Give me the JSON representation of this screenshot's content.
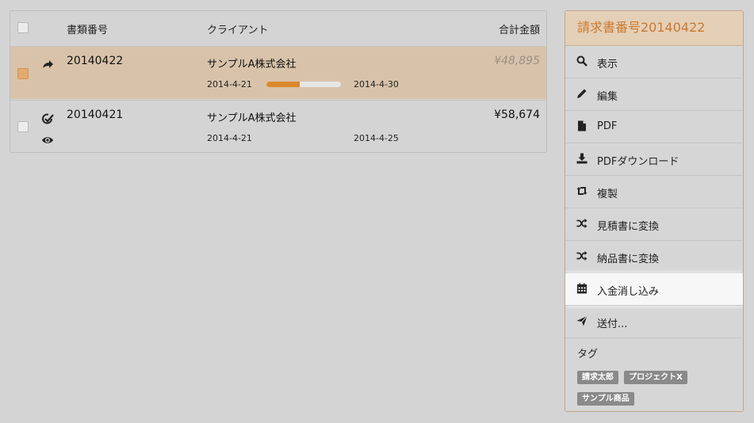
{
  "table": {
    "headers": {
      "number": "書類番号",
      "client": "クライアント",
      "total": "合計金額"
    },
    "rows": [
      {
        "id": "20140422",
        "client": "サンプルA株式会社",
        "start_date": "2014-4-21",
        "end_date": "2014-4-30",
        "amount": "¥48,895",
        "selected": true,
        "progress": 0.45,
        "status_icon": "share-arrow-icon"
      },
      {
        "id": "20140421",
        "client": "サンプルA株式会社",
        "start_date": "2014-4-21",
        "end_date": "2014-4-25",
        "amount": "¥58,674",
        "selected": false,
        "status_icons": [
          "check-circle-icon",
          "eye-icon"
        ]
      }
    ]
  },
  "sidebar": {
    "title": "請求書番号20140422",
    "menu": [
      {
        "label": "表示",
        "icon": "search-icon"
      },
      {
        "label": "編集",
        "icon": "pencil-icon"
      },
      {
        "label": "PDF",
        "icon": "file-icon"
      },
      {
        "label": "PDFダウンロード",
        "icon": "download-icon"
      },
      {
        "label": "複製",
        "icon": "retweet-icon"
      },
      {
        "label": "見積書に変換",
        "icon": "shuffle-icon"
      },
      {
        "label": "納品書に変換",
        "icon": "shuffle-icon"
      },
      {
        "label": "入金消し込み",
        "icon": "calendar-icon"
      },
      {
        "label": "送付...",
        "icon": "send-icon"
      }
    ],
    "active_item": "入金消し込み",
    "tags_title": "タグ",
    "tags": [
      "請求太郎",
      "プロジェクトX",
      "サンプル商品"
    ]
  },
  "colors": {
    "accent": "#cc7a2e",
    "selected_row": "#d8c3aa",
    "progress": "#da8a2c",
    "background": "#d4d4d4"
  }
}
